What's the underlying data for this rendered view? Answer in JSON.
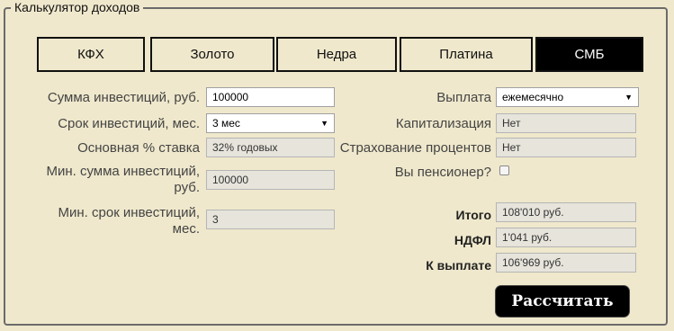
{
  "panel": {
    "title": "Калькулятор доходов"
  },
  "tabs": [
    {
      "label": "КФХ"
    },
    {
      "label": "Золото"
    },
    {
      "label": "Недра"
    },
    {
      "label": "Платина"
    },
    {
      "label": "СМБ",
      "active": true
    }
  ],
  "left": {
    "sum": {
      "label": "Сумма инвестиций, руб.",
      "value": "100000"
    },
    "term": {
      "label": "Срок инвестиций, мес.",
      "value": "3 мес"
    },
    "rate": {
      "label": "Основная % ставка",
      "value": "32% годовых"
    },
    "min_sum": {
      "label_line1": "Мин. сумма инвестиций,",
      "label_line2": "руб.",
      "value": "100000"
    },
    "min_term": {
      "label_line1": "Мин. срок инвестиций,",
      "label_line2": "мес.",
      "value": "3"
    }
  },
  "right": {
    "payout": {
      "label": "Выплата",
      "value": "ежемесячно"
    },
    "capitalization": {
      "label": "Капитализация",
      "value": "Нет"
    },
    "insurance": {
      "label": "Страхование процентов",
      "value": "Нет"
    },
    "pensioner": {
      "label": "Вы пенсионер?",
      "checked": false
    },
    "total": {
      "label": "Итого",
      "value": "108'010 руб."
    },
    "ndfl": {
      "label": "НДФЛ",
      "value": "1'041 руб."
    },
    "payable": {
      "label": "К выплате",
      "value": "106'969 руб."
    }
  },
  "actions": {
    "calculate": "Рассчитать"
  },
  "colors": {
    "background": "#efe8cc",
    "active_tab": "#000000",
    "readonly_field": "#e6e4db"
  }
}
